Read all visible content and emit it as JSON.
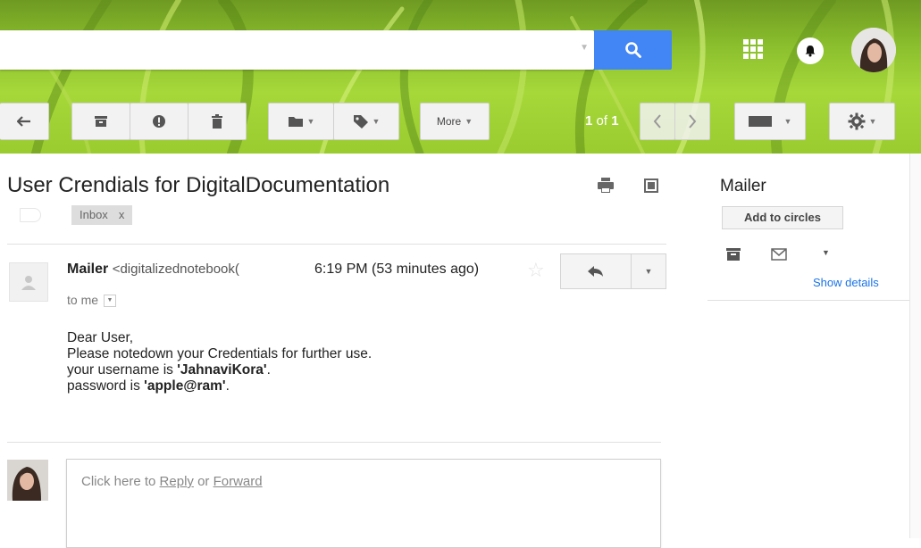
{
  "search": {
    "placeholder": ""
  },
  "toolbar": {
    "more_label": "More",
    "pager_current": "1",
    "pager_of": "of",
    "pager_total": "1"
  },
  "email": {
    "subject": "User Crendials for DigitalDocumentation",
    "label": "Inbox",
    "label_remove": "x",
    "sender_name": "Mailer",
    "sender_email": "<digitalizednotebook(",
    "time": "6:19 PM (53 minutes ago)",
    "recipient": "to me",
    "body": {
      "greeting": "Dear User,",
      "line1": "Please notedown your Credentials for further use.",
      "line2_prefix": "your username is ",
      "username": "'JahnaviKora'",
      "line2_suffix": ".",
      "line3_prefix": "password is ",
      "password": "'apple@ram'",
      "line3_suffix": "."
    },
    "reply_prompt_prefix": "Click here to ",
    "reply_link": "Reply",
    "reply_or": " or ",
    "forward_link": "Forward"
  },
  "contact_panel": {
    "name": "Mailer",
    "add_circles": "Add to circles",
    "show_details": "Show details"
  },
  "colors": {
    "search_button": "#4285f4",
    "link": "#1a73e8",
    "theme_green": "#8bbf2d"
  },
  "icons": [
    "search-icon",
    "apps-icon",
    "notifications-icon",
    "back-icon",
    "archive-icon",
    "spam-icon",
    "delete-icon",
    "folder-icon",
    "label-icon",
    "prev-icon",
    "next-icon",
    "keyboard-icon",
    "gear-icon",
    "print-icon",
    "new-window-icon",
    "star-icon",
    "reply-icon",
    "person-icon",
    "contact-card-icon",
    "mail-icon"
  ]
}
